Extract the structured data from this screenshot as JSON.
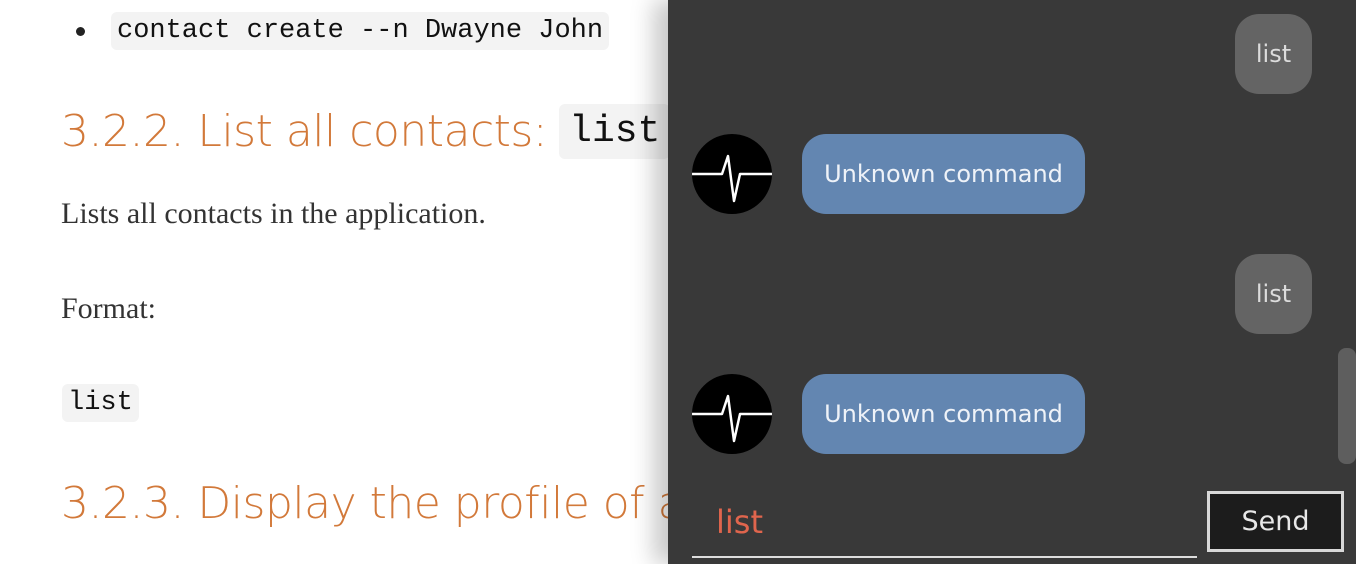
{
  "document": {
    "bullet_command": "contact create --n Dwayne John",
    "section_list_heading": "3.2.2. List all contacts:",
    "section_list_code": "list",
    "list_description": "Lists all contacts in the application.",
    "format_label": "Format:",
    "format_code": "list",
    "section_profile_heading": "3.2.3. Display the profile of a"
  },
  "chat": {
    "messages": [
      {
        "sender": "user",
        "text": "list"
      },
      {
        "sender": "bot",
        "text": "Unknown command"
      },
      {
        "sender": "user",
        "text": "list"
      },
      {
        "sender": "bot",
        "text": "Unknown command"
      }
    ],
    "input_value": "list",
    "send_label": "Send",
    "colors": {
      "panel_bg": "#393939",
      "user_bubble": "#646464",
      "bot_bubble": "#6386b1",
      "input_text": "#e0654d",
      "heading": "#d2793a"
    },
    "bot_avatar_icon": "heartbeat-icon"
  }
}
